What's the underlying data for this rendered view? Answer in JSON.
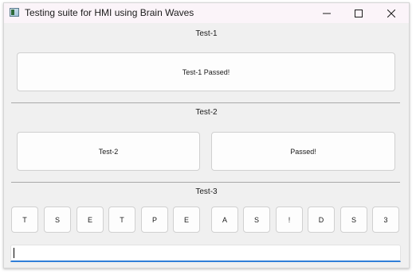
{
  "window": {
    "title": "Testing suite for HMI using Brain Waves"
  },
  "test1": {
    "label": "Test-1",
    "result_button": "Test-1 Passed!"
  },
  "test2": {
    "label": "Test-2",
    "left_button": "Test-2",
    "right_button": "Passed!"
  },
  "test3": {
    "label": "Test-3",
    "keys": [
      "T",
      "S",
      "E",
      "T",
      "P",
      "E",
      "A",
      "S",
      "!",
      "D",
      "S",
      "3"
    ]
  },
  "input": {
    "value": ""
  },
  "icons": {
    "app": "app-window-icon",
    "minimize": "minimize-icon",
    "maximize": "maximize-icon",
    "close": "close-icon"
  }
}
